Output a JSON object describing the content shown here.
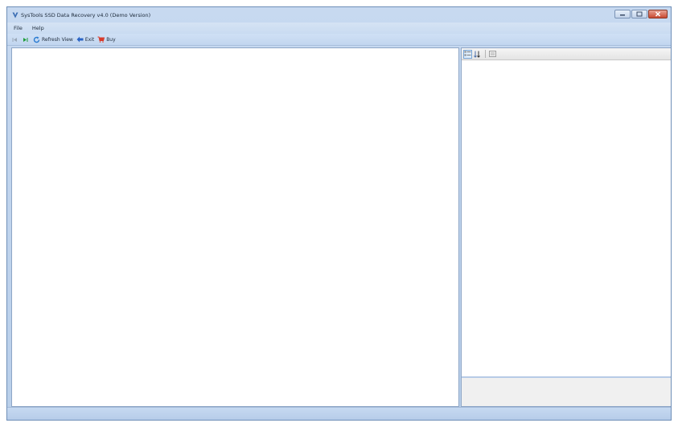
{
  "window": {
    "title": "SysTools SSD Data Recovery v4.0 (Demo Version)"
  },
  "menu": {
    "items": [
      {
        "label": "File"
      },
      {
        "label": "Help"
      }
    ]
  },
  "toolbar": {
    "prev_icon": "first-page-icon",
    "next_icon": "next-page-icon",
    "refresh_label": "Refresh View",
    "exit_label": "Exit",
    "buy_label": "Buy"
  },
  "property_panel": {
    "buttons": [
      "categorized-icon",
      "alphabetical-sort-icon",
      "property-pages-icon"
    ]
  },
  "colors": {
    "title_bg": "#c7d9f0",
    "close_red": "#c84a32",
    "accent_blue": "#2a7bd1"
  }
}
